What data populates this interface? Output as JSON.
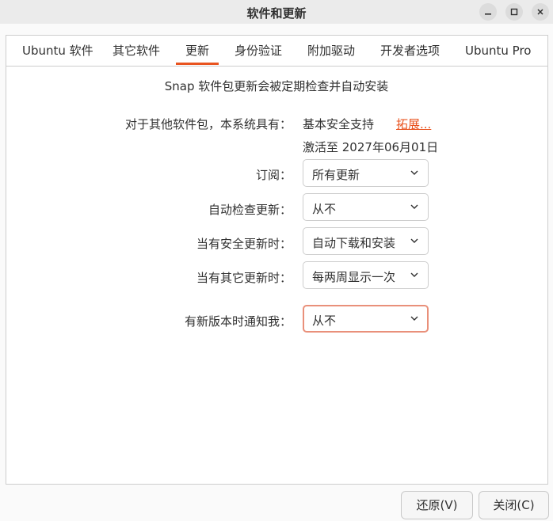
{
  "window": {
    "title": "软件和更新",
    "controls": {
      "minimize_icon": "minimize-icon",
      "maximize_icon": "maximize-icon",
      "close_icon": "close-icon"
    }
  },
  "tabs": [
    {
      "label": "Ubuntu 软件",
      "active": false
    },
    {
      "label": "其它软件",
      "active": false
    },
    {
      "label": "更新",
      "active": true
    },
    {
      "label": "身份验证",
      "active": false
    },
    {
      "label": "附加驱动",
      "active": false
    },
    {
      "label": "开发者选项",
      "active": false
    },
    {
      "label": "Ubuntu Pro",
      "active": false
    }
  ],
  "updates": {
    "snap_notice": "Snap 软件包更新会被定期检查并自动安装",
    "support": {
      "label": "对于其他软件包，本系统具有：",
      "value": "基本安全支持",
      "extend_link": "拓展...",
      "activation": "激活至 2027年06月01日"
    },
    "subscribe": {
      "label": "订阅：",
      "value": "所有更新"
    },
    "auto_check": {
      "label": "自动检查更新：",
      "value": "从不"
    },
    "security_updates": {
      "label": "当有安全更新时：",
      "value": "自动下载和安装"
    },
    "other_updates": {
      "label": "当有其它更新时：",
      "value": "每两周显示一次"
    },
    "notify_new_version": {
      "label": "有新版本时通知我：",
      "value": "从不"
    }
  },
  "buttons": {
    "revert": "还原(V)",
    "close": "关闭(C)"
  },
  "colors": {
    "accent": "#e95420",
    "focus_border": "#e9907a"
  }
}
